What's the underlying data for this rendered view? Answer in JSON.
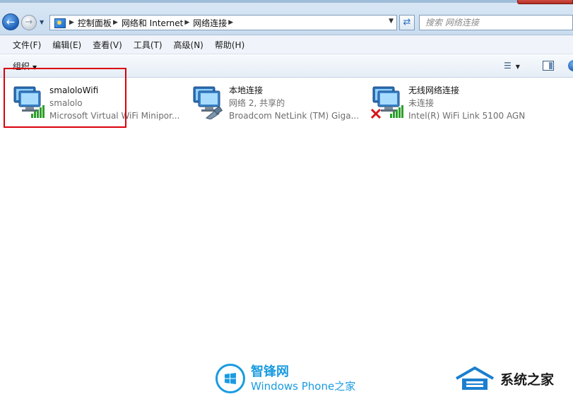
{
  "address": {
    "breadcrumbs": [
      "控制面板",
      "网络和 Internet",
      "网络连接"
    ]
  },
  "search": {
    "placeholder": "搜索 网络连接"
  },
  "menu": [
    "文件(F)",
    "编辑(E)",
    "查看(V)",
    "工具(T)",
    "高级(N)",
    "帮助(H)"
  ],
  "toolbar": {
    "organize_label": "组织"
  },
  "connections": [
    {
      "name": "smaloloWifi",
      "status": "smalolo",
      "adapter": "Microsoft Virtual WiFi Minipor...",
      "icon": "wifi-monitor-icon"
    },
    {
      "name": "本地连接",
      "status": "网络  2, 共享的",
      "adapter": "Broadcom NetLink (TM) Giga...",
      "icon": "ethernet-monitor-icon"
    },
    {
      "name": "无线网络连接",
      "status": "未连接",
      "adapter": "Intel(R) WiFi Link 5100 AGN",
      "icon": "wifi-disconnected-icon"
    }
  ],
  "watermarks": {
    "left_cn": "智锋网",
    "left_en": "Windows Phone之家",
    "right": "系统之家"
  },
  "colors": {
    "highlight": "#d9000c",
    "watermark_blue": "#1a9be0"
  }
}
